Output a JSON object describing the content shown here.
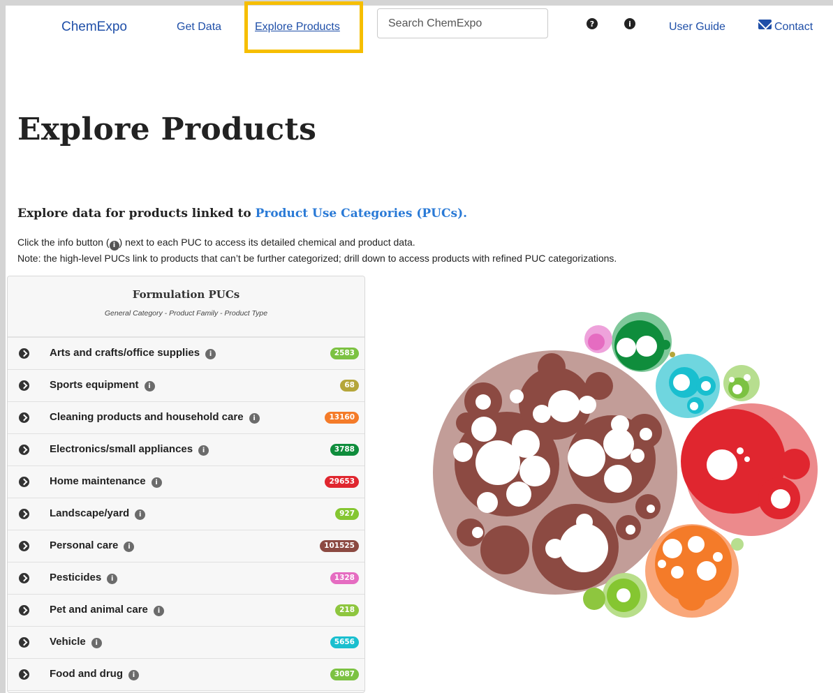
{
  "nav": {
    "brand": "ChemExpo",
    "get_data": "Get Data",
    "explore_products": "Explore Products",
    "search_placeholder": "Search ChemExpo",
    "help_icon": "question-circle-icon",
    "about_icon": "info-circle-icon",
    "user_guide": "User Guide",
    "contact": "Contact",
    "contact_icon": "envelope-icon",
    "highlight_color": "#f6be00"
  },
  "page": {
    "title": "Explore Products",
    "subhead_prefix": "Explore data for products linked to ",
    "subhead_link": "Product Use Categories (PUCs).",
    "note1_a": "Click the info button (",
    "note1_b": ") next to each PUC to access its detailed chemical and product data.",
    "note2": "Note: the high-level PUCs link to products that can’t be further categorized; drill down to access products with refined PUC categorizations."
  },
  "panel": {
    "title": "Formulation PUCs",
    "subtitle": "General Category - Product Family - Product Type",
    "rows": [
      {
        "label": "Arts and crafts/office supplies",
        "count": "2583",
        "color": "#7cc242"
      },
      {
        "label": "Sports equipment",
        "count": "68",
        "color": "#b5a63a"
      },
      {
        "label": "Cleaning products and household care",
        "count": "13160",
        "color": "#f47b29"
      },
      {
        "label": "Electronics/small appliances",
        "count": "3788",
        "color": "#0f8d3c"
      },
      {
        "label": "Home maintenance",
        "count": "29653",
        "color": "#e0262f"
      },
      {
        "label": "Landscape/yard",
        "count": "927",
        "color": "#85c631"
      },
      {
        "label": "Personal care",
        "count": "101525",
        "color": "#8c4a42"
      },
      {
        "label": "Pesticides",
        "count": "1328",
        "color": "#e56cc1"
      },
      {
        "label": "Pet and animal care",
        "count": "218",
        "color": "#8ec63f"
      },
      {
        "label": "Vehicle",
        "count": "5656",
        "color": "#19bfcf"
      },
      {
        "label": "Food and drug",
        "count": "3087",
        "color": "#7cc242"
      }
    ]
  }
}
